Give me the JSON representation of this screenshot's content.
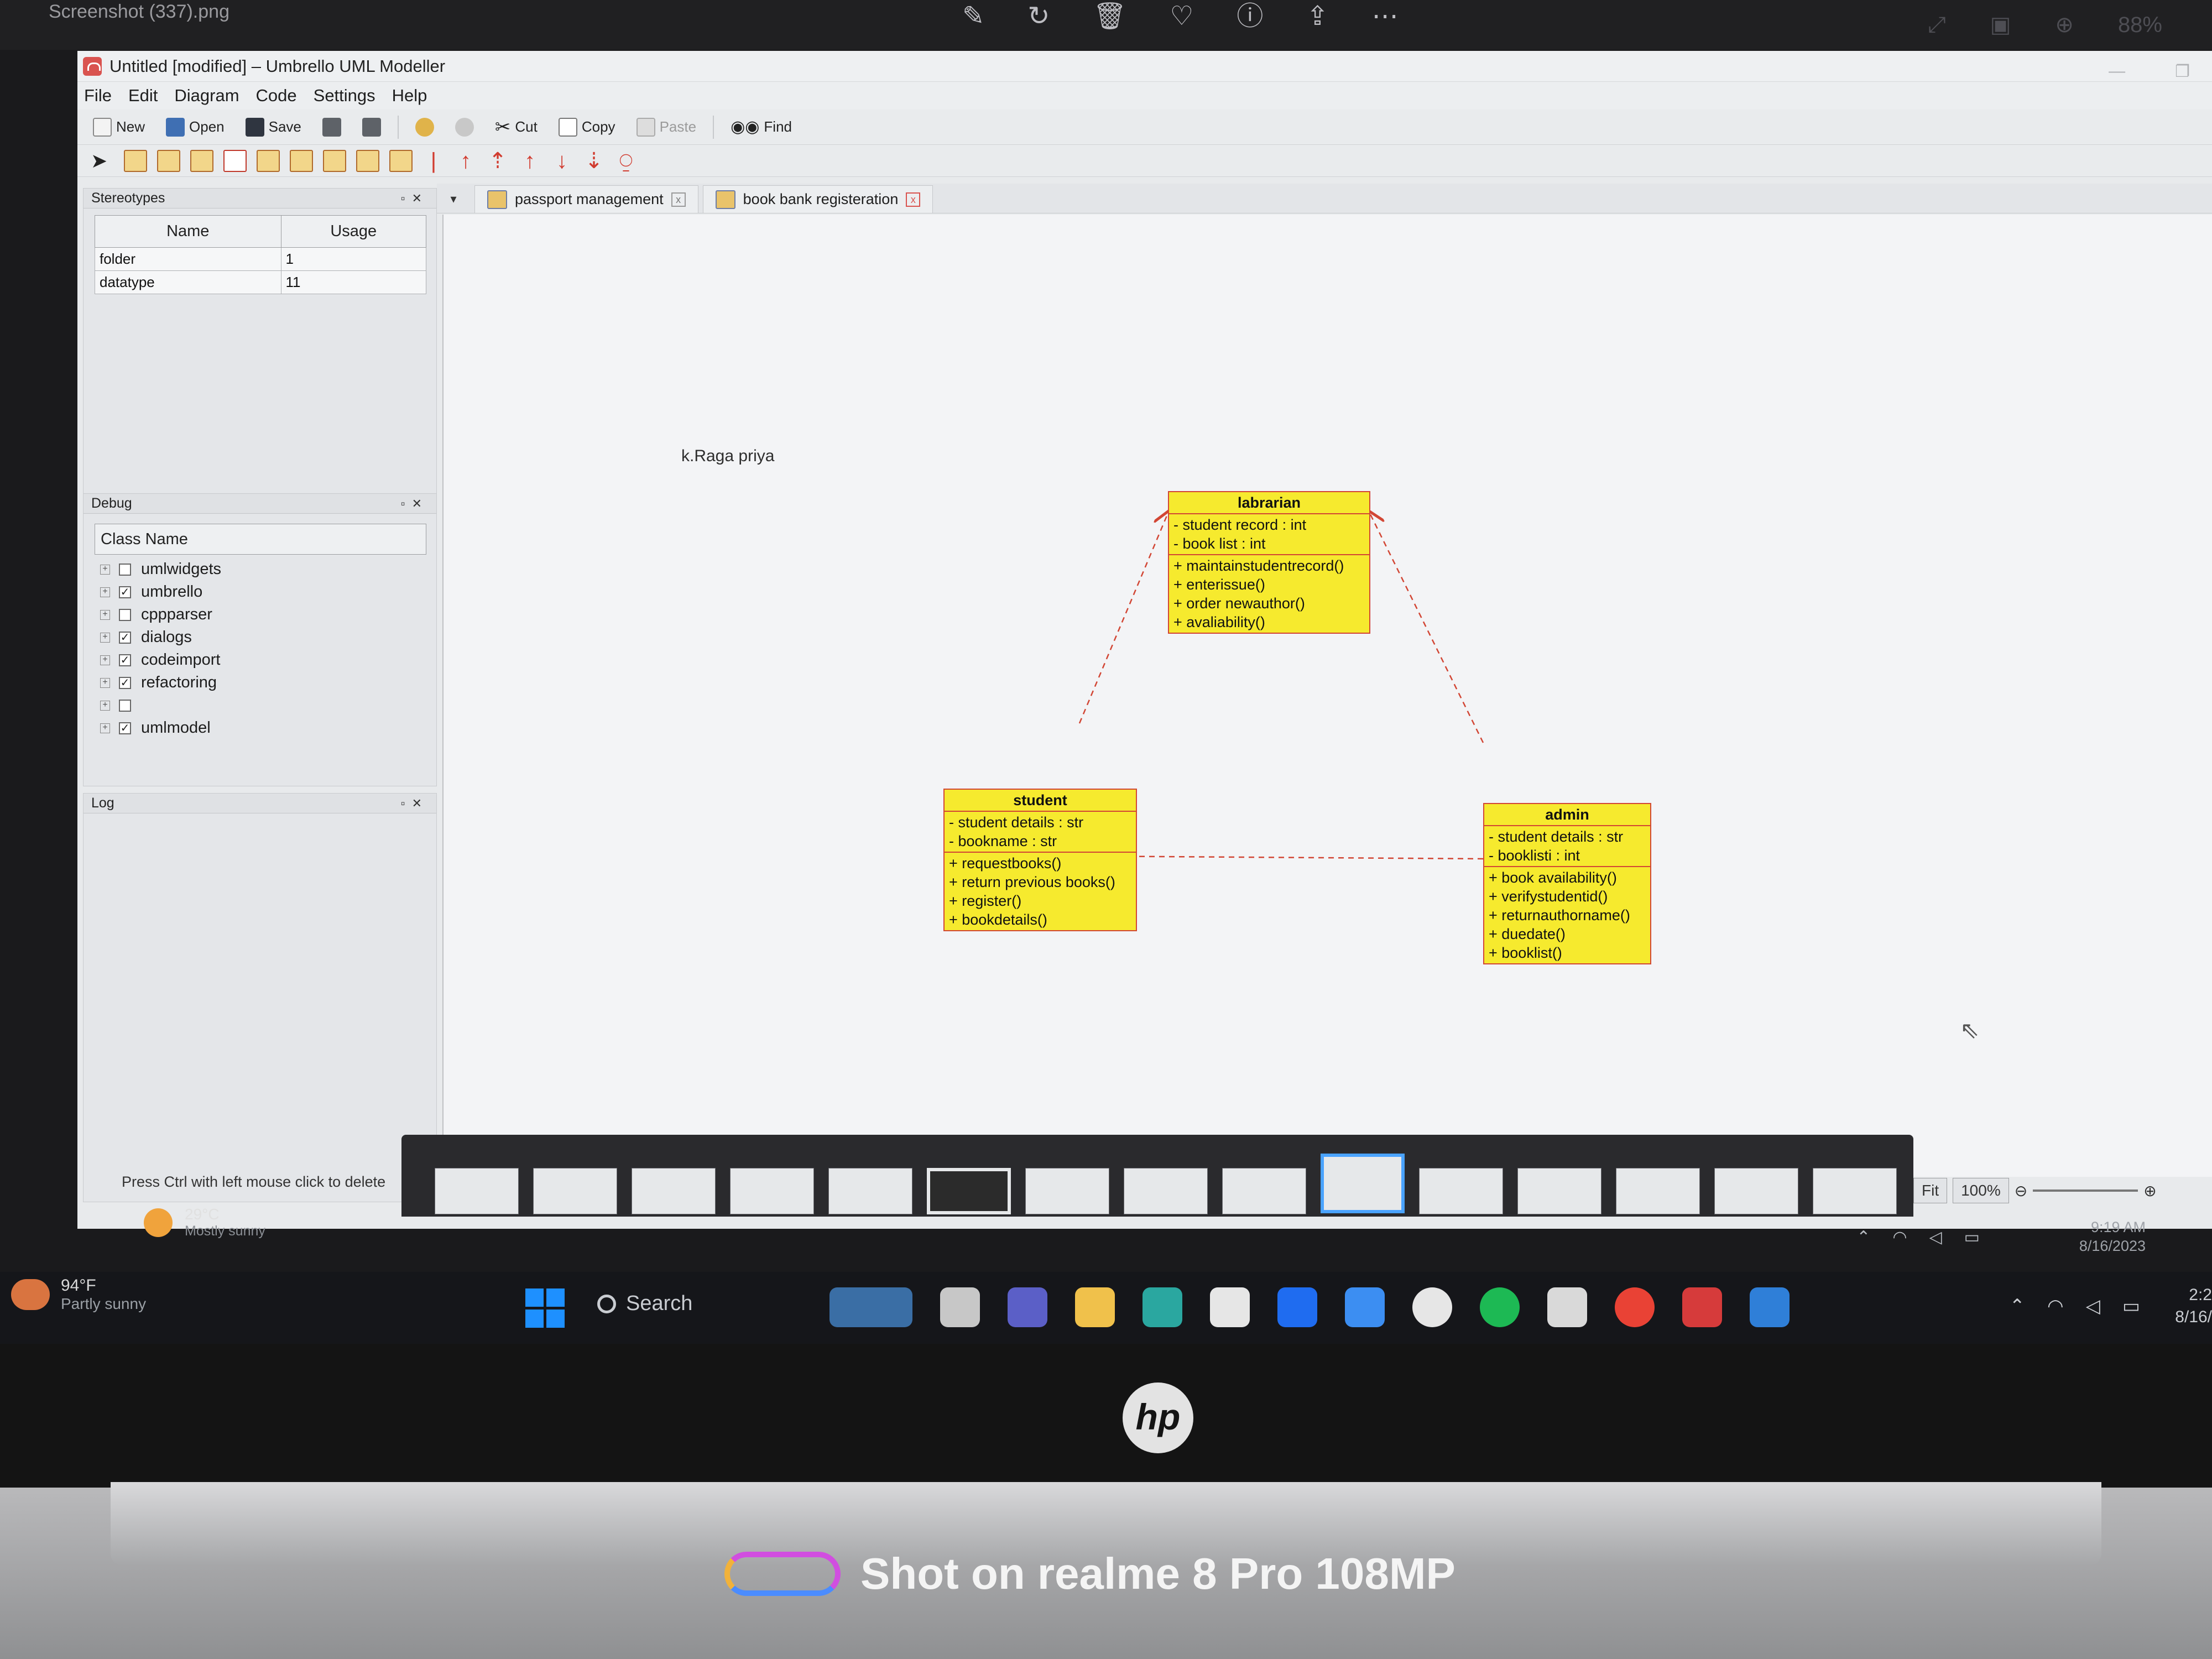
{
  "photo_viewer": {
    "file_name": "Screenshot (337).png",
    "zoom": "88%"
  },
  "window": {
    "title": "Untitled [modified] – Umbrello UML Modeller",
    "menu": [
      "File",
      "Edit",
      "Diagram",
      "Code",
      "Settings",
      "Help"
    ]
  },
  "toolbar": {
    "new": "New",
    "open": "Open",
    "save": "Save",
    "cut": "Cut",
    "copy": "Copy",
    "paste": "Paste",
    "find": "Find"
  },
  "stereotypes": {
    "title": "Stereotypes",
    "columns": [
      "Name",
      "Usage"
    ],
    "rows": [
      {
        "name": "folder",
        "usage": "1"
      },
      {
        "name": "datatype",
        "usage": "11"
      }
    ]
  },
  "debug": {
    "title": "Debug",
    "column": "Class Name",
    "items": [
      {
        "label": "umlwidgets",
        "checked": false
      },
      {
        "label": "umbrello",
        "checked": true
      },
      {
        "label": "cppparser",
        "checked": false
      },
      {
        "label": "dialogs",
        "checked": true
      },
      {
        "label": "codeimport",
        "checked": true
      },
      {
        "label": "refactoring",
        "checked": true
      },
      {
        "label": "",
        "checked": false
      },
      {
        "label": "umlmodel",
        "checked": true
      }
    ]
  },
  "log": {
    "title": "Log"
  },
  "status": "Press Ctrl with left mouse click to delete",
  "tabs": [
    {
      "label": "passport management",
      "close": "x"
    },
    {
      "label": "book bank registeration",
      "close": "x"
    }
  ],
  "diagram": {
    "note": "k.Raga priya",
    "classes": [
      {
        "name": "labrarian",
        "attributes": [
          "- student record : int",
          "- book list : int"
        ],
        "operations": [
          "+ maintainstudentrecord()",
          "+ enterissue()",
          "+ order newauthor()",
          "+ avaliability()"
        ]
      },
      {
        "name": "student",
        "attributes": [
          "- student details : str",
          "- bookname : str"
        ],
        "operations": [
          "+ requestbooks()",
          "+ return previous books()",
          "+ register()",
          "+ bookdetails()"
        ]
      },
      {
        "name": "admin",
        "attributes": [
          "- student details : str",
          "- booklisti : int"
        ],
        "operations": [
          "+ book availability()",
          "+ verifystudentid()",
          "+ returnauthorname()",
          "+ duedate()",
          "+ booklist()"
        ]
      }
    ]
  },
  "zoom_controls": {
    "fit": "Fit",
    "zoom": "100%"
  },
  "inner_taskbar": {
    "temp": "29°C",
    "weather": "Mostly sunny",
    "time": "9:19 AM",
    "date": "8/16/2023"
  },
  "taskbar": {
    "temp": "94°F",
    "weather": "Partly sunny",
    "search": "Search",
    "time": "2:2",
    "date": "8/16/"
  },
  "watermark": "Shot on realme 8 Pro 108MP",
  "colors": {
    "class_fill": "#f6ea2e",
    "class_border": "#d24634",
    "link": "#d24634"
  }
}
